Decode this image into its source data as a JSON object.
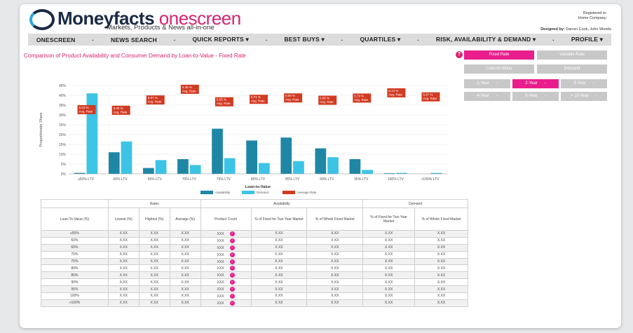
{
  "header": {
    "brand": "Moneyfacts",
    "brand_suffix": "onescreen",
    "tagline": "Markets, Products & News all-in-one",
    "registered_label": "Registered to:",
    "home_company_label": "Home Company:",
    "designed_label": "Designed by:",
    "designed_names": "Darren Cook, John Woods"
  },
  "nav": [
    "ONESCREEN",
    "·",
    "NEWS SEARCH",
    "·",
    "QUICK REPORTS ▾",
    "·",
    "BEST BUYS ▾",
    "·",
    "QUARTILES ▾",
    "·",
    "RISK, AVAILABILITY & DEMAND ▾",
    "·",
    "PROFILE ▾"
  ],
  "page_title": "Comparison of Product Availability and Consumer Demand by Loan-to-Value - Fixed Rate",
  "help_label": "?",
  "controls": {
    "fixed_rate": "Fixed Rate",
    "variable_rate": "Variable Rate",
    "loan_to_value": "Loan-to-Value",
    "demand": "Demand",
    "term_1": "1-Year",
    "term_2": "2-Year",
    "term_3": "3-Year",
    "term_4": "4-Year",
    "term_5": "5-Year",
    "term_10": "> 10-Year",
    "dd": "-"
  },
  "colors": {
    "availability": "#1e87a6",
    "demand": "#3cc4e6",
    "average_rate": "#d23a22",
    "accent": "#e91e8c"
  },
  "chart_data": {
    "type": "bar",
    "categories": [
      "≤50% LTV",
      "60% LTV",
      "65% LTV",
      "70% LTV",
      "75% LTV",
      "80% LTV",
      "85% LTV",
      "90% LTV",
      "95% LTV",
      "100% LTV",
      ">100% LTV"
    ],
    "series": [
      {
        "name": "Availability",
        "values": [
          0.5,
          11,
          3,
          7.5,
          23,
          17,
          18.5,
          13,
          7.5,
          0.3,
          0
        ]
      },
      {
        "name": "Demand",
        "values": [
          41,
          16.5,
          7,
          4.5,
          8,
          5.5,
          6.5,
          8.5,
          2,
          0.5,
          0.5
        ]
      }
    ],
    "avg_rate_labels": [
      "5.04 %\nAvg. Rate",
      "5.00 %\nAvg. Rate",
      "5.67 %\nAvg. Rate",
      "6.36 %\nAvg. Rate",
      "5.55 %\nAvg. Rate",
      "5.71 %\nAvg. Rate",
      "5.80 %\nAvg. Rate",
      "5.65 %\nAvg. Rate",
      "5.79 %\nAvg. Rate",
      "6.13 %\nAvg. Rate",
      "5.87 %\nAvg. Rate"
    ],
    "avg_rate_values": [
      5.04,
      5.0,
      5.67,
      6.36,
      5.55,
      5.71,
      5.8,
      5.65,
      5.79,
      6.13,
      5.87
    ],
    "yticks": [
      "0%",
      "5%",
      "10%",
      "15%",
      "20%",
      "25%",
      "30%",
      "35%",
      "40%",
      "45%"
    ],
    "ylim": [
      0,
      45
    ],
    "xlabel": "Loan-to-Value",
    "ylabel": "Proportionate Share",
    "legend": [
      "Availability",
      "Demand",
      "Average Rate"
    ],
    "legend_position": "bottom",
    "grid": true
  },
  "table": {
    "group_headers": [
      "",
      "Rates",
      "Availability",
      "Demand"
    ],
    "headers": [
      "Loan-To-Value (%)",
      "Lowest (%)",
      "Highest (%)",
      "Average (%)",
      "Product Count",
      "% of Fixed for Two Year Market",
      "% of Whole Fixed Market",
      "% of Fixed for Two Year Market",
      "% of Whole Fixed Market"
    ],
    "rows": [
      [
        "≤50%",
        "X.XX",
        "X.XX",
        "X.XX",
        "XXX",
        "X.XX",
        "X.XX",
        "X.XX",
        "X.XX"
      ],
      [
        "60%",
        "X.XX",
        "X.XX",
        "X.XX",
        "XXX",
        "X.XX",
        "X.XX",
        "X.XX",
        "X.XX"
      ],
      [
        "65%",
        "X.XX",
        "X.XX",
        "X.XX",
        "XXX",
        "X.XX",
        "X.XX",
        "X.XX",
        "X.XX"
      ],
      [
        "70%",
        "X.XX",
        "X.XX",
        "X.XX",
        "XXX",
        "X.XX",
        "X.XX",
        "X.XX",
        "X.XX"
      ],
      [
        "75%",
        "X.XX",
        "X.XX",
        "X.XX",
        "XXX",
        "X.XX",
        "X.XX",
        "X.XX",
        "X.XX"
      ],
      [
        "80%",
        "X.XX",
        "X.XX",
        "X.XX",
        "XXX",
        "X.XX",
        "X.XX",
        "X.XX",
        "X.XX"
      ],
      [
        "85%",
        "X.XX",
        "X.XX",
        "X.XX",
        "XXX",
        "X.XX",
        "X.XX",
        "X.XX",
        "X.XX"
      ],
      [
        "90%",
        "X.XX",
        "X.XX",
        "X.XX",
        "XXX",
        "X.XX",
        "X.XX",
        "X.XX",
        "X.XX"
      ],
      [
        "95%",
        "X.XX",
        "X.XX",
        "X.XX",
        "XXX",
        "X.XX",
        "X.XX",
        "X.XX",
        "X.XX"
      ],
      [
        "100%",
        "X.XX",
        "X.XX",
        "X.XX",
        "XXX",
        "X.XX",
        "X.XX",
        "X.XX",
        "X.XX"
      ],
      [
        ">100%",
        "X.XX",
        "X.XX",
        "X.XX",
        "XXX",
        "X.XX",
        "X.XX",
        "X.XX",
        "X.XX"
      ]
    ],
    "row_arrow": "›"
  }
}
